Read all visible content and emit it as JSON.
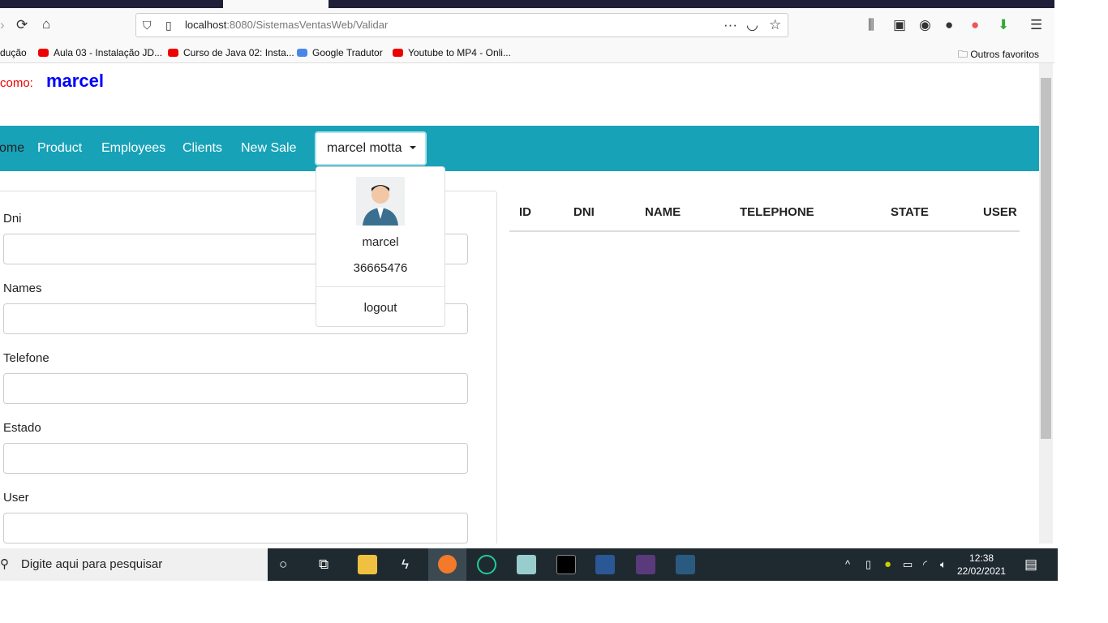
{
  "browser": {
    "url_host": "localhost",
    "url_path": ":8080/SistemasVentasWeb/Validar"
  },
  "bookmarks": [
    "dução",
    "Aula 03 - Instalação JD...",
    "Curso de Java 02: Insta...",
    "Google Tradutor",
    "Youtube to MP4 - Onli...",
    "Outros favoritos"
  ],
  "header": {
    "welcome": "como:",
    "username": "marcel"
  },
  "nav": {
    "items": [
      "ome",
      "Product",
      "Employees",
      "Clients",
      "New Sale"
    ],
    "user_button": "marcel motta"
  },
  "dropdown": {
    "name": "marcel",
    "dni": "36665476",
    "logout": "logout"
  },
  "form": {
    "labels": [
      "Dni",
      "Names",
      "Telefone",
      "Estado",
      "User"
    ]
  },
  "table": {
    "headers": [
      "ID",
      "DNI",
      "NAME",
      "TELEPHONE",
      "STATE",
      "USER"
    ]
  },
  "taskbar": {
    "search_placeholder": "Digite aqui para pesquisar",
    "time": "12:38",
    "date": "22/02/2021"
  },
  "colors": {
    "nav": "#17a2b8",
    "username": "#0000ff",
    "welcome": "#ee0000"
  }
}
